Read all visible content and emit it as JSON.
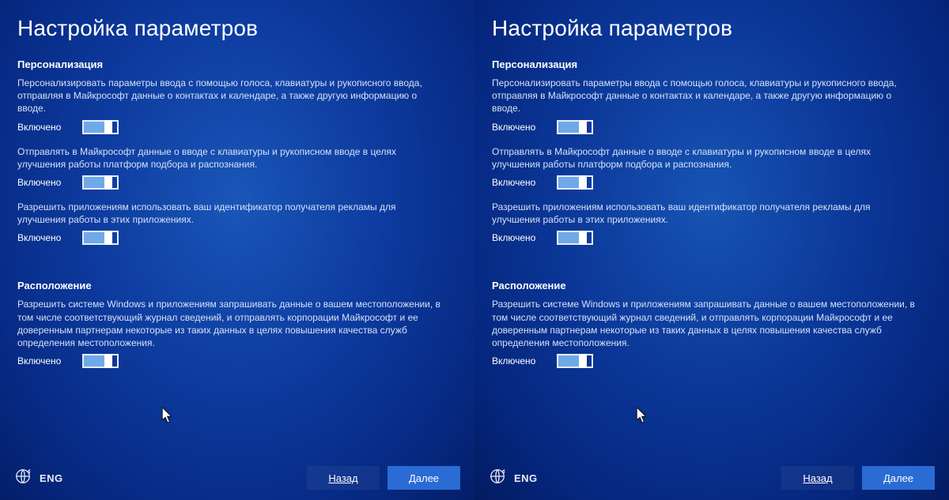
{
  "title": "Настройка параметров",
  "sections": {
    "personalization": {
      "heading": "Персонализация",
      "items": [
        {
          "desc": "Персонализировать параметры ввода с помощью голоса, клавиатуры и рукописного ввода, отправляя в Майкрософт данные о контактах и календаре, а также другую информацию о вводе.",
          "state_label": "Включено"
        },
        {
          "desc": "Отправлять в Майкрософт данные о вводе с клавиатуры и рукописном вводе в целях улучшения работы платформ подбора и распознания.",
          "state_label": "Включено"
        },
        {
          "desc": "Разрешить приложениям использовать ваш идентификатор получателя рекламы для улучшения работы в этих приложениях.",
          "state_label": "Включено"
        }
      ]
    },
    "location": {
      "heading": "Расположение",
      "items": [
        {
          "desc": "Разрешить системе Windows и приложениям запрашивать данные о вашем местоположении, в том числе соответствующий журнал сведений, и отправлять корпорации Майкрософт и ее доверенным партнерам некоторые из таких данных в целях повышения качества служб определения местоположения.",
          "state_label": "Включено"
        }
      ]
    }
  },
  "footer": {
    "lang": "ENG",
    "back": "Назад",
    "next": "Далее"
  }
}
